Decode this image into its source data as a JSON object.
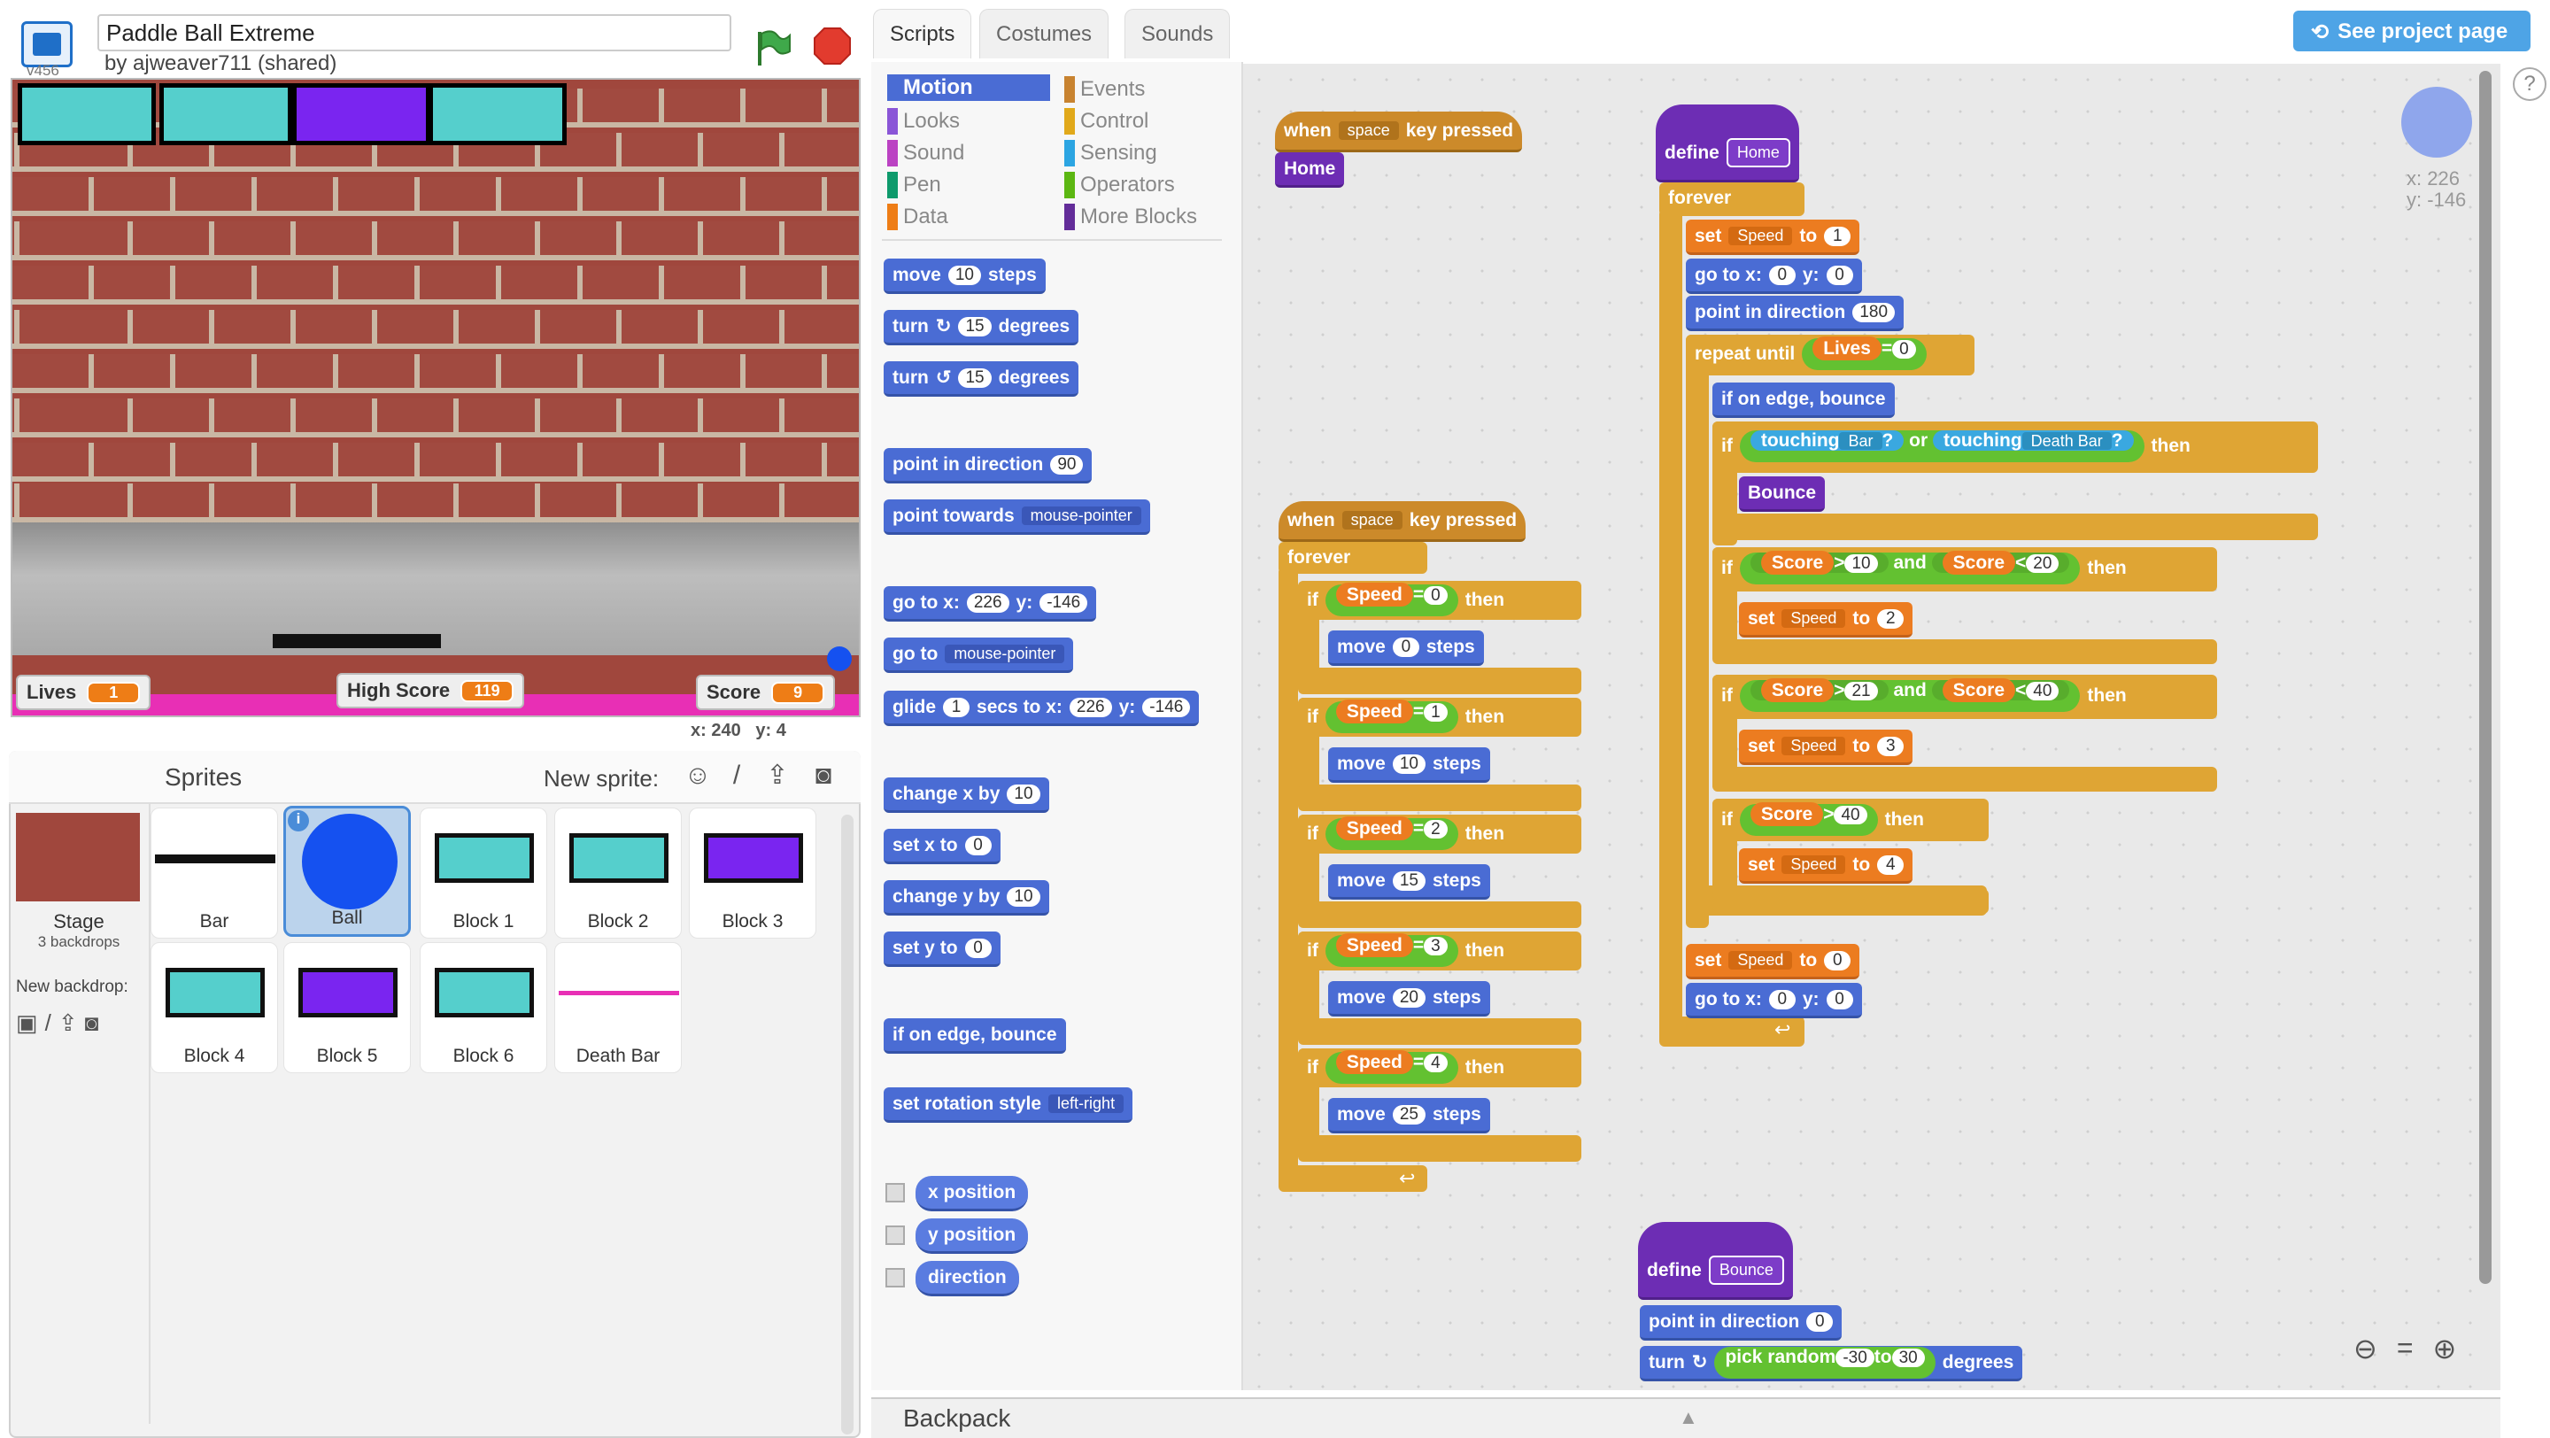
{
  "header": {
    "version": "v456",
    "project_title": "Paddle Ball Extreme",
    "byline": "by ajweaver711 (shared)"
  },
  "stage": {
    "hud": {
      "lives_label": "Lives",
      "lives_value": "1",
      "highscore_label": "High Score",
      "highscore_value": "119",
      "score_label": "Score",
      "score_value": "9"
    },
    "mouse_x": "x: 240",
    "mouse_y": "y: 4"
  },
  "sprites_pane": {
    "title": "Sprites",
    "new_sprite_label": "New sprite:",
    "stage_label": "Stage",
    "stage_backdrops": "3 backdrops",
    "new_backdrop_label": "New backdrop:",
    "sprites": [
      {
        "name": "Bar"
      },
      {
        "name": "Ball"
      },
      {
        "name": "Block 1"
      },
      {
        "name": "Block 2"
      },
      {
        "name": "Block 3"
      },
      {
        "name": "Block 4"
      },
      {
        "name": "Block 5"
      },
      {
        "name": "Block 6"
      },
      {
        "name": "Death Bar"
      }
    ]
  },
  "tabs": [
    "Scripts",
    "Costumes",
    "Sounds"
  ],
  "see_project": "See project page",
  "categories": {
    "left": [
      "Motion",
      "Looks",
      "Sound",
      "Pen",
      "Data"
    ],
    "right": [
      "Events",
      "Control",
      "Sensing",
      "Operators",
      "More Blocks"
    ],
    "colors": {
      "Motion": "#4a6cd4",
      "Looks": "#8a55d7",
      "Sound": "#bb42c3",
      "Pen": "#0e9a6c",
      "Data": "#ee7d16",
      "Events": "#c88330",
      "Control": "#e1a91a",
      "Sensing": "#2ca5e2",
      "Operators": "#5cb712",
      "More Blocks": "#632d99"
    }
  },
  "palette": {
    "move": [
      "move",
      "10",
      "steps"
    ],
    "turn_right": [
      "turn",
      "15",
      "degrees"
    ],
    "turn_left": [
      "turn",
      "15",
      "degrees"
    ],
    "point_dir": [
      "point in direction",
      "90"
    ],
    "point_towards": [
      "point towards",
      "mouse-pointer"
    ],
    "goto_xy": [
      "go to x:",
      "226",
      "y:",
      "-146"
    ],
    "goto": [
      "go to",
      "mouse-pointer"
    ],
    "glide": [
      "glide",
      "1",
      "secs to x:",
      "226",
      "y:",
      "-146"
    ],
    "change_x": [
      "change x by",
      "10"
    ],
    "set_x": [
      "set x to",
      "0"
    ],
    "change_y": [
      "change y by",
      "10"
    ],
    "set_y": [
      "set y to",
      "0"
    ],
    "bounce": "if on edge, bounce",
    "rot_style": [
      "set rotation style",
      "left-right"
    ],
    "x_position": "x position",
    "y_position": "y position",
    "direction": "direction"
  },
  "scripts": {
    "kw": {
      "when": "when",
      "key_pressed": "key pressed",
      "space": "space",
      "forever": "forever",
      "if": "if",
      "then": "then",
      "move": "move",
      "steps": "steps",
      "define": "define",
      "set": "set",
      "to": "to",
      "go_to_x": "go to x:",
      "y": "y:",
      "point_in_direction": "point in direction",
      "repeat_until": "repeat until",
      "bounce_edge": "if on edge, bounce",
      "touching": "touching",
      "q": "?",
      "or": "or",
      "and": "and",
      "turn": "turn",
      "pick_random": "pick random",
      "degrees": "degrees",
      "eq": "=",
      "gt": ">",
      "lt": "<"
    },
    "vars": {
      "speed": "Speed",
      "lives": "Lives",
      "score": "Score"
    },
    "procs": {
      "home": "Home",
      "bounce": "Bounce"
    },
    "sprites_ref": {
      "bar": "Bar",
      "death_bar": "Death Bar"
    },
    "nums": {
      "n0": "0",
      "n1": "1",
      "n2": "2",
      "n3": "3",
      "n4": "4",
      "m0": "0",
      "m10": "10",
      "m15": "15",
      "m20": "20",
      "m25": "25",
      "d180": "180",
      "c10": "10",
      "c20": "20",
      "c21": "21",
      "c40": "40",
      "r1": "-30",
      "r2": "30",
      "d0": "0"
    }
  },
  "sprite_info": {
    "x": "x: 226",
    "y": "y: -146"
  },
  "backpack": "Backpack"
}
